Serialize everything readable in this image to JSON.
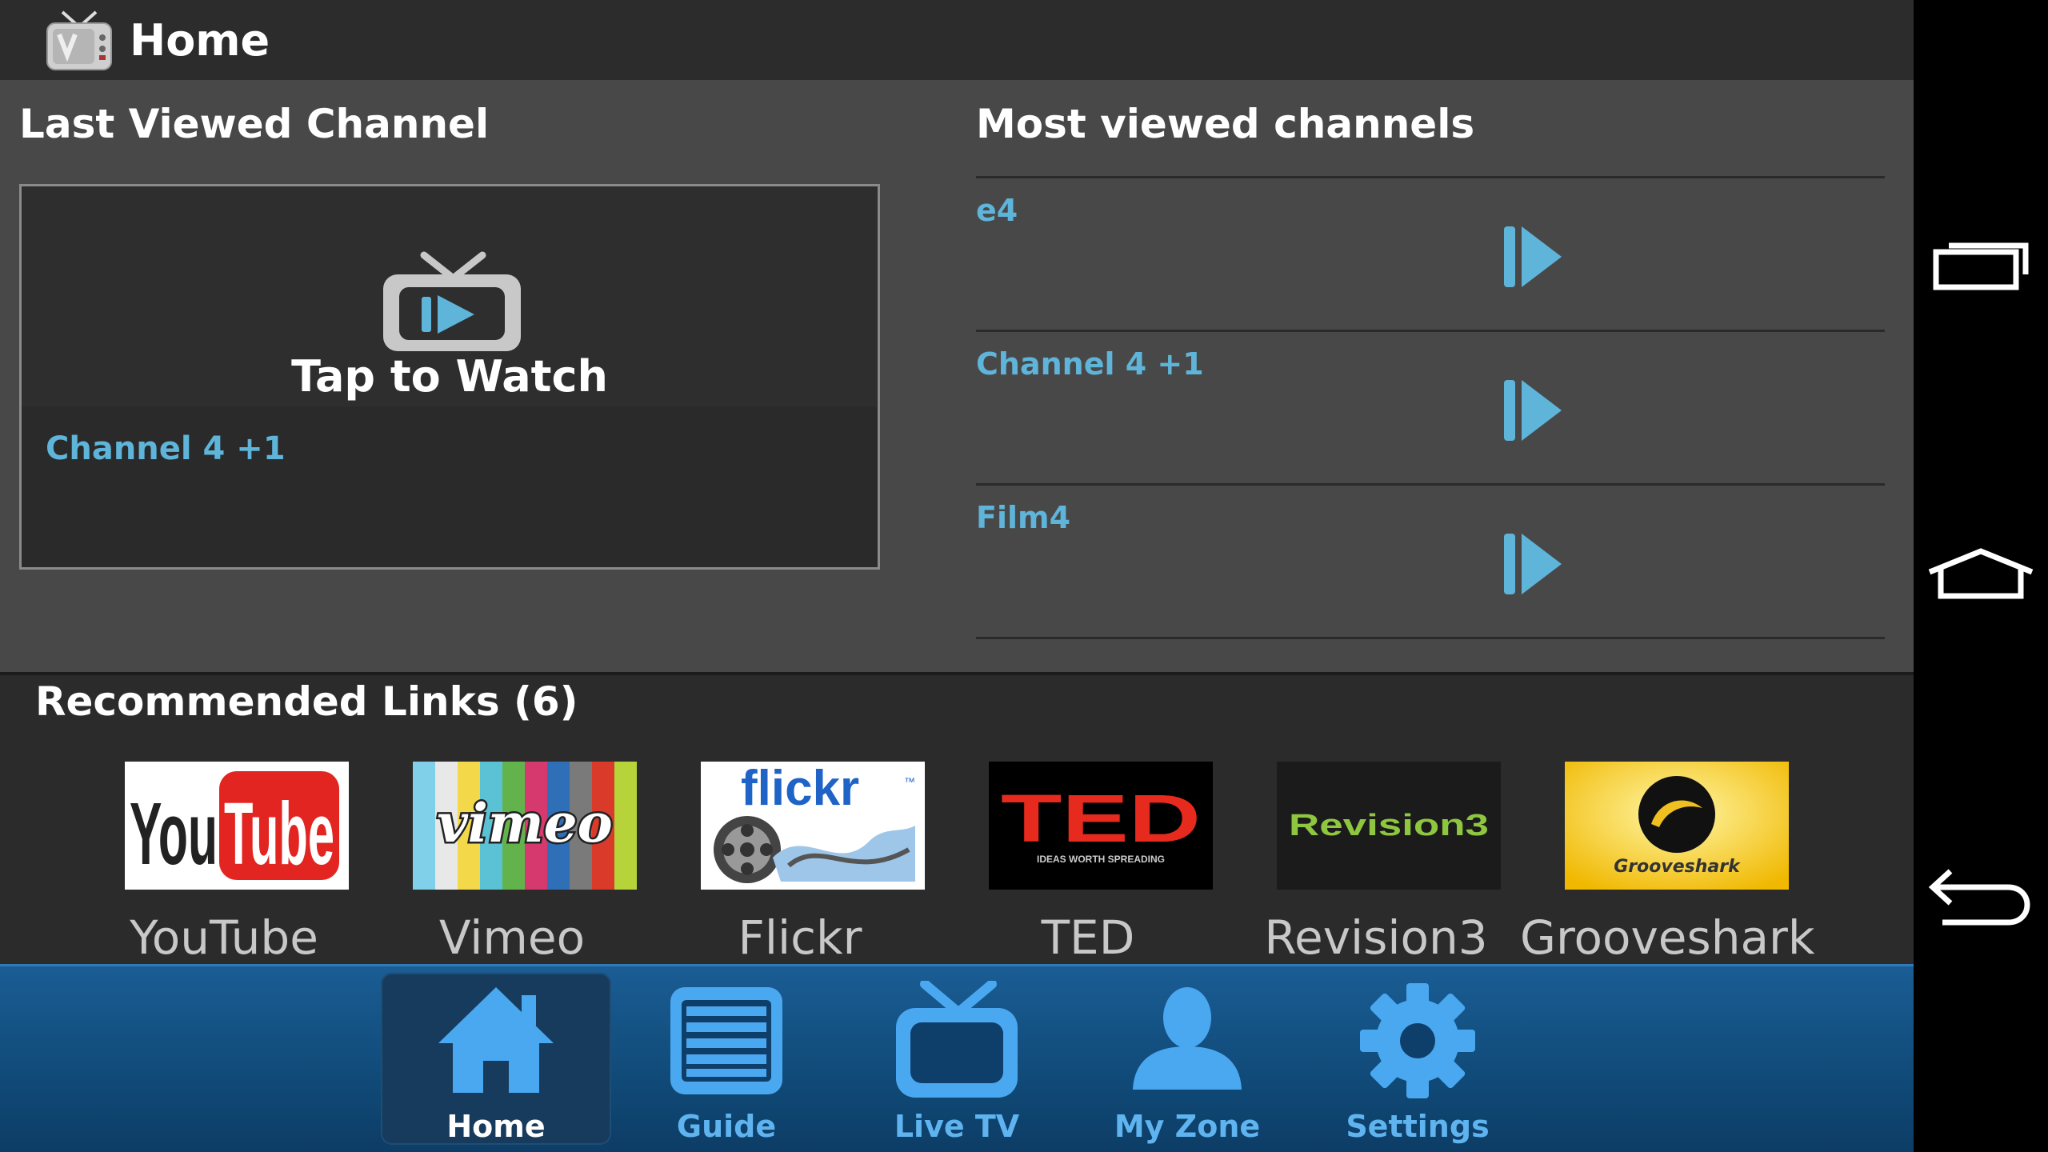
{
  "colors": {
    "accent": "#5fb4d9",
    "nav_accent": "#5fb4f0",
    "nav_bg": "#104a78"
  },
  "action_bar": {
    "title": "Home",
    "icon": "tv-box-icon"
  },
  "last_viewed": {
    "heading": "Last Viewed Channel",
    "tap_label": "Tap to Watch",
    "channel": "Channel 4 +1"
  },
  "most_viewed": {
    "heading": "Most viewed channels",
    "items": [
      {
        "name": "e4"
      },
      {
        "name": "Channel 4 +1"
      },
      {
        "name": "Film4"
      }
    ]
  },
  "recommended": {
    "heading": "Recommended Links (6)",
    "items": [
      {
        "label": "YouTube",
        "logo_text_1": "You",
        "logo_text_2": "Tube"
      },
      {
        "label": "Vimeo",
        "logo_text": "vimeo"
      },
      {
        "label": "Flickr",
        "logo_text": "flickr",
        "logo_tm": "™"
      },
      {
        "label": "TED",
        "logo_text": "TED",
        "logo_sub": "IDEAS WORTH SPREADING"
      },
      {
        "label": "Revision3",
        "logo_text": "Revision3"
      },
      {
        "label": "Grooveshark",
        "logo_text": "Grooveshark"
      }
    ]
  },
  "bottom_nav": {
    "items": [
      {
        "label": "Home",
        "icon": "home-icon",
        "active": true
      },
      {
        "label": "Guide",
        "icon": "guide-icon"
      },
      {
        "label": "Live TV",
        "icon": "tv-icon"
      },
      {
        "label": "My Zone",
        "icon": "person-icon"
      },
      {
        "label": "Settings",
        "icon": "gear-icon"
      }
    ]
  },
  "system_bar": {
    "buttons": [
      "recent-apps-icon",
      "home-outline-icon",
      "back-icon"
    ]
  }
}
